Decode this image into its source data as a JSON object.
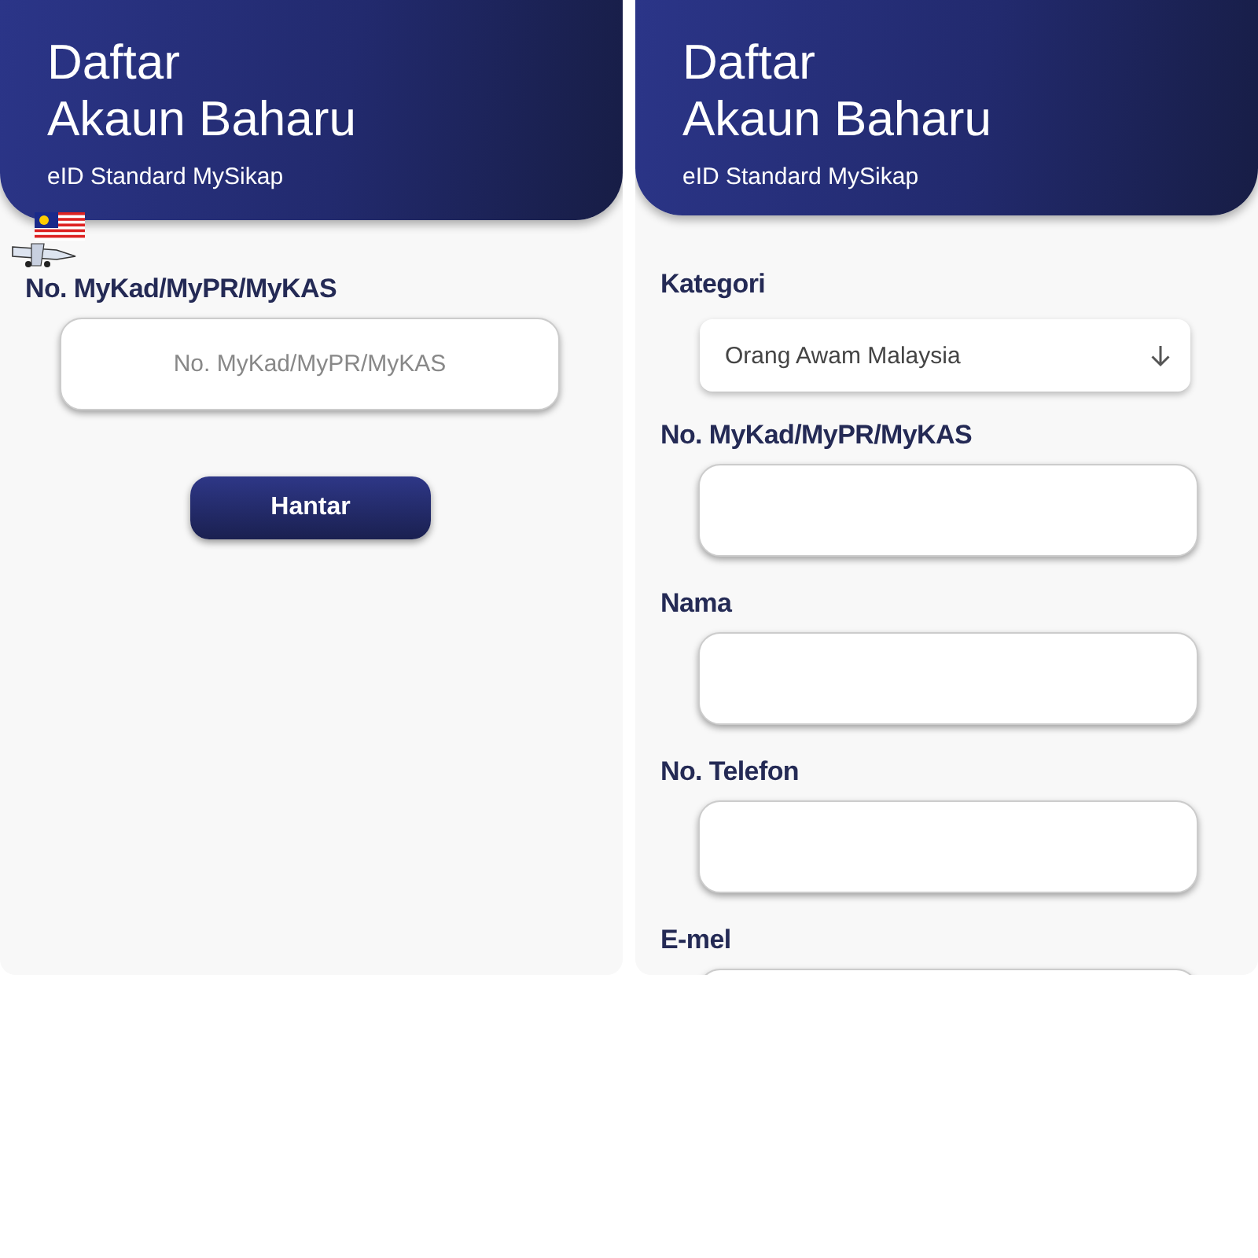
{
  "screens": [
    {
      "header": {
        "title_lines": [
          "Daftar",
          "Akaun Baharu"
        ],
        "subtitle": "eID Standard MySikap"
      },
      "sticker": {
        "kind": "flag-plane"
      },
      "fields": [
        {
          "kind": "text",
          "label": "No. MyKad/MyPR/MyKAS",
          "placeholder": "No. MyKad/MyPR/MyKAS"
        }
      ],
      "button": "Hantar"
    },
    {
      "header": {
        "title_lines": [
          "Daftar",
          "Akaun Baharu"
        ],
        "subtitle": "eID Standard MySikap"
      },
      "fields": [
        {
          "kind": "select",
          "label": "Kategori",
          "value": "Orang Awam Malaysia"
        },
        {
          "kind": "text",
          "label": "No. MyKad/MyPR/MyKAS"
        },
        {
          "kind": "text",
          "label": "Nama"
        },
        {
          "kind": "text",
          "label": "No. Telefon"
        },
        {
          "kind": "text",
          "label": "E-mel"
        }
      ]
    }
  ]
}
